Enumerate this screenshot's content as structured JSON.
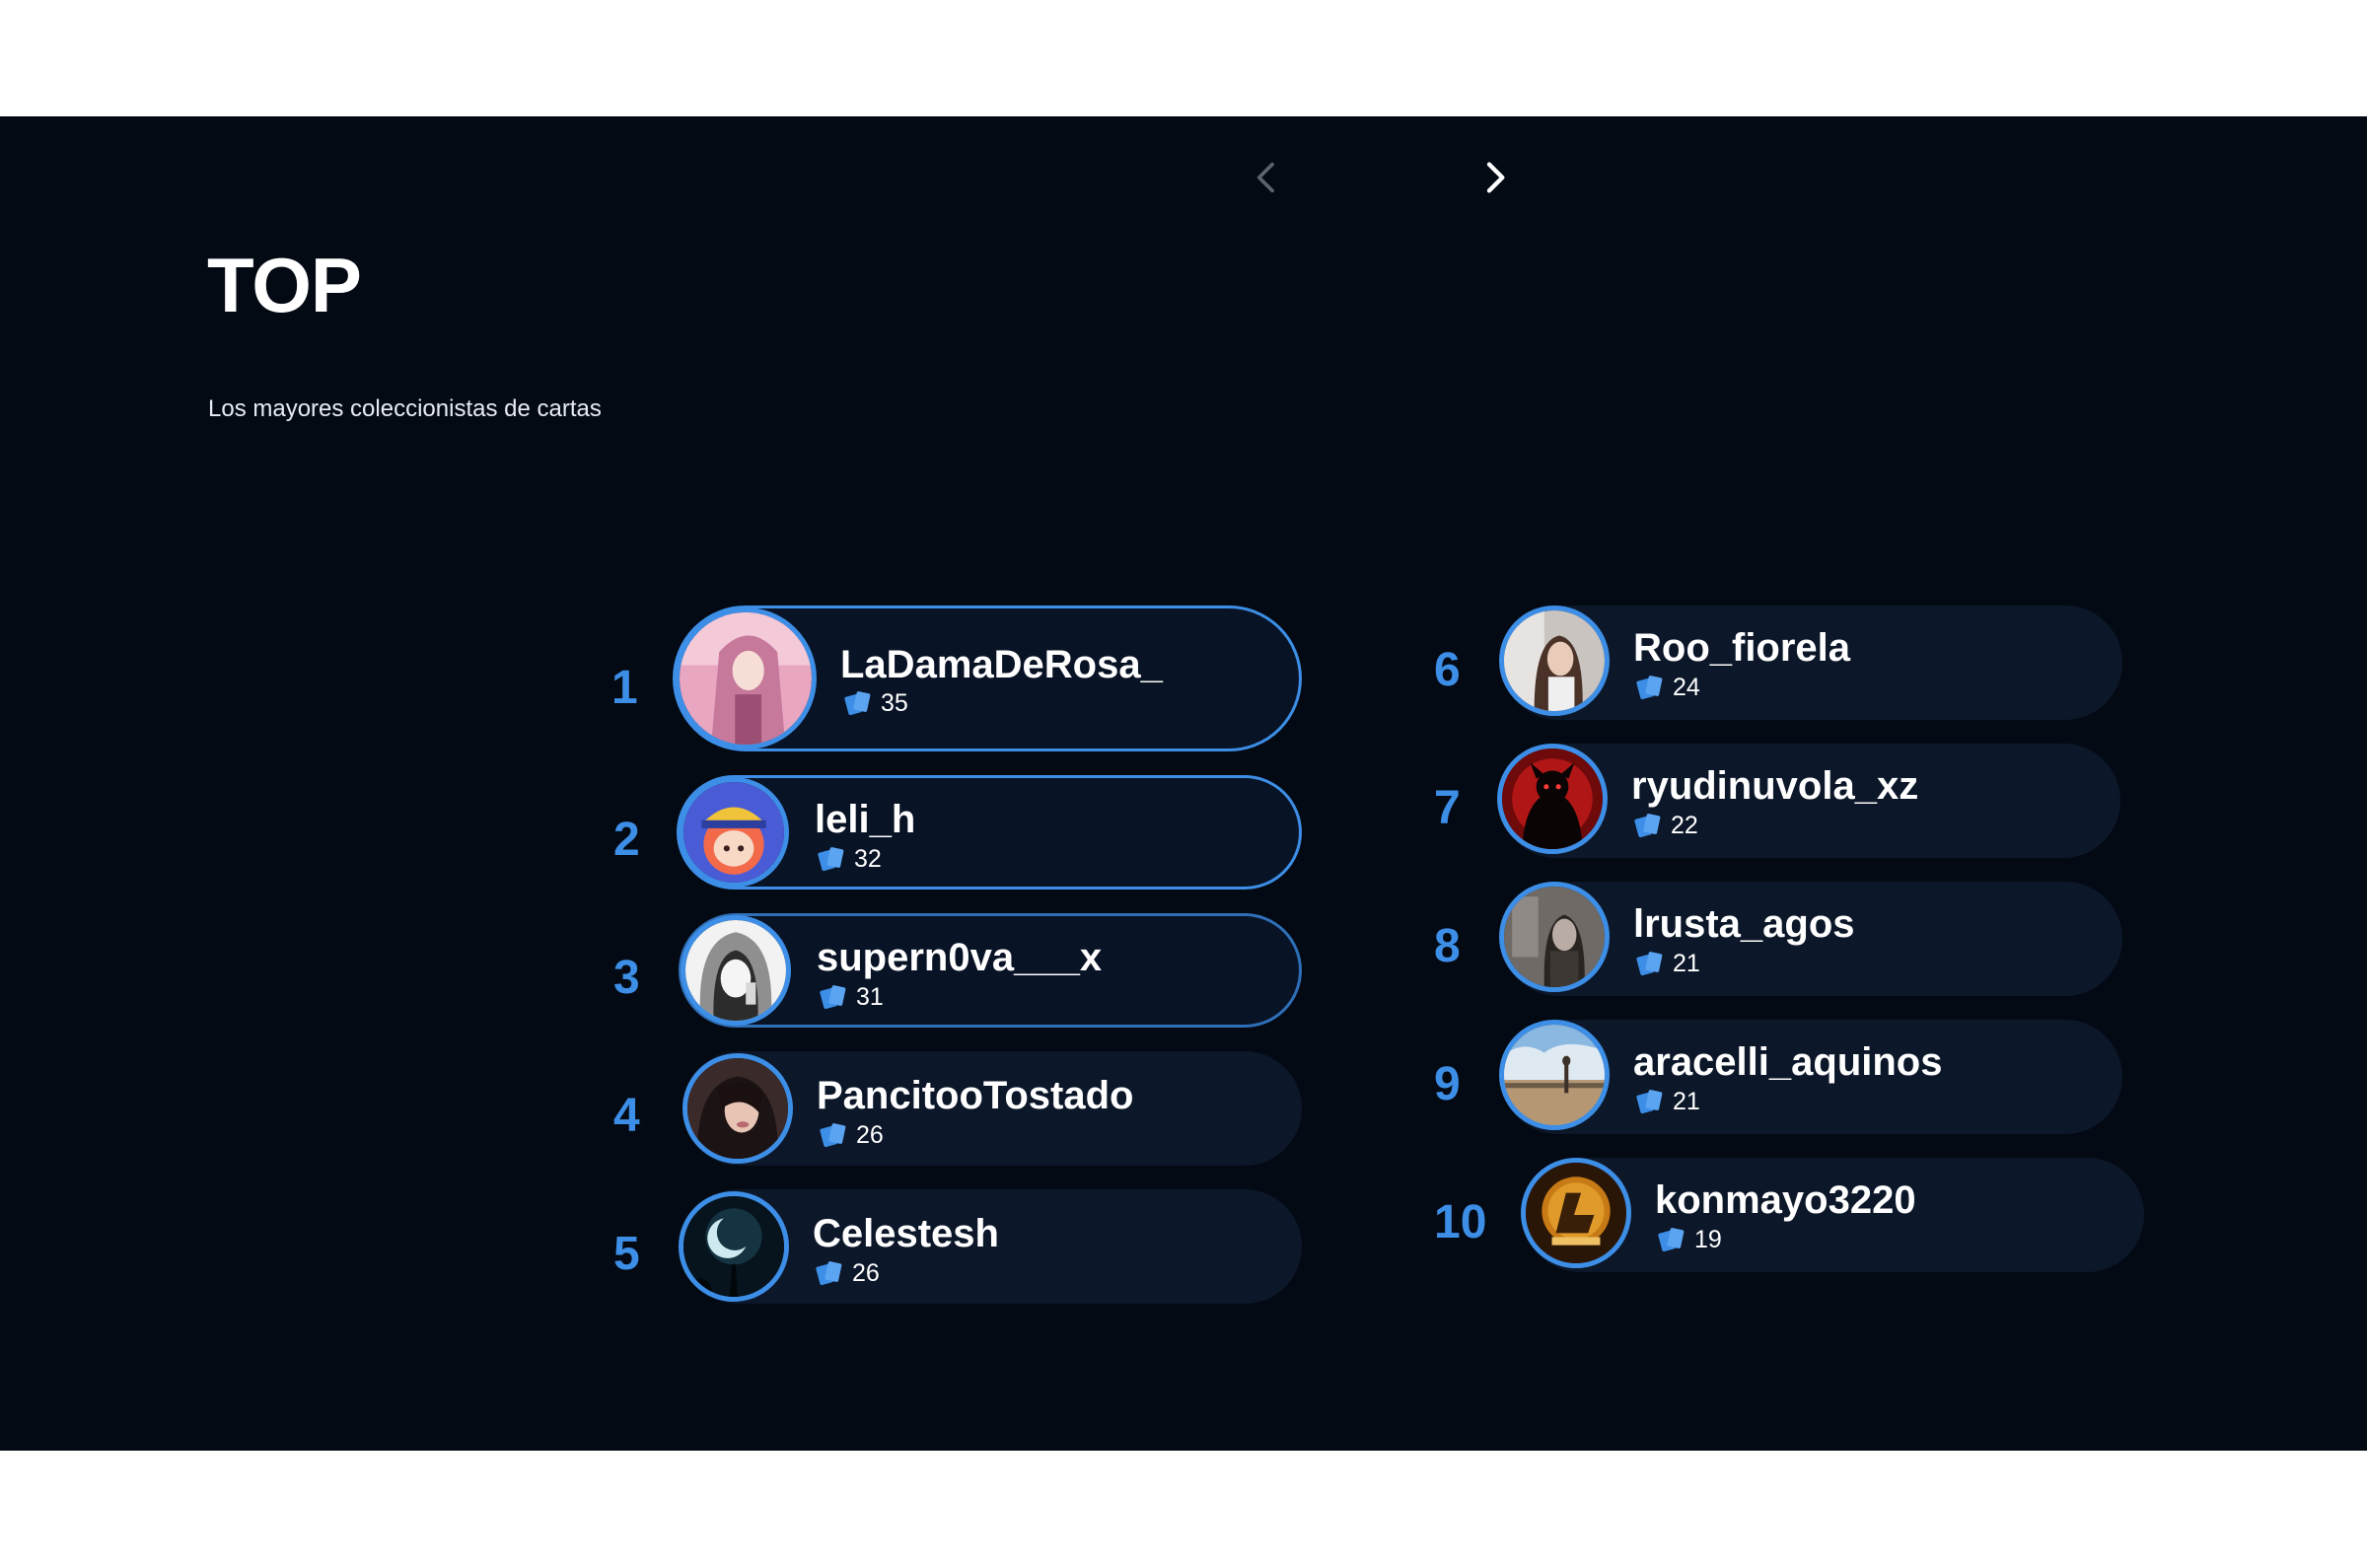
{
  "header": {
    "title": "TOP",
    "subtitle": "Los mayores coleccionistas de cartas"
  },
  "colors": {
    "background": "#040a14",
    "accent": "#3d8ee6",
    "row": "#0c1729",
    "text": "#ffffff"
  },
  "navigation": {
    "prev_icon": "chevron-left-icon",
    "next_icon": "chevron-right-icon"
  },
  "ranking": [
    {
      "rank": "1",
      "username": "LaDamaDeRosa_",
      "cards": "35"
    },
    {
      "rank": "2",
      "username": "leli_h",
      "cards": "32"
    },
    {
      "rank": "3",
      "username": "supern0va___x",
      "cards": "31"
    },
    {
      "rank": "4",
      "username": "PancitooTostado",
      "cards": "26"
    },
    {
      "rank": "5",
      "username": "Celestesh",
      "cards": "26"
    },
    {
      "rank": "6",
      "username": "Roo_fiorela",
      "cards": "24"
    },
    {
      "rank": "7",
      "username": "ryudinuvola_xz",
      "cards": "22"
    },
    {
      "rank": "8",
      "username": "lrusta_agos",
      "cards": "21"
    },
    {
      "rank": "9",
      "username": "aracelli_aquinos",
      "cards": "21"
    },
    {
      "rank": "10",
      "username": "konmayo3220",
      "cards": "19"
    }
  ]
}
